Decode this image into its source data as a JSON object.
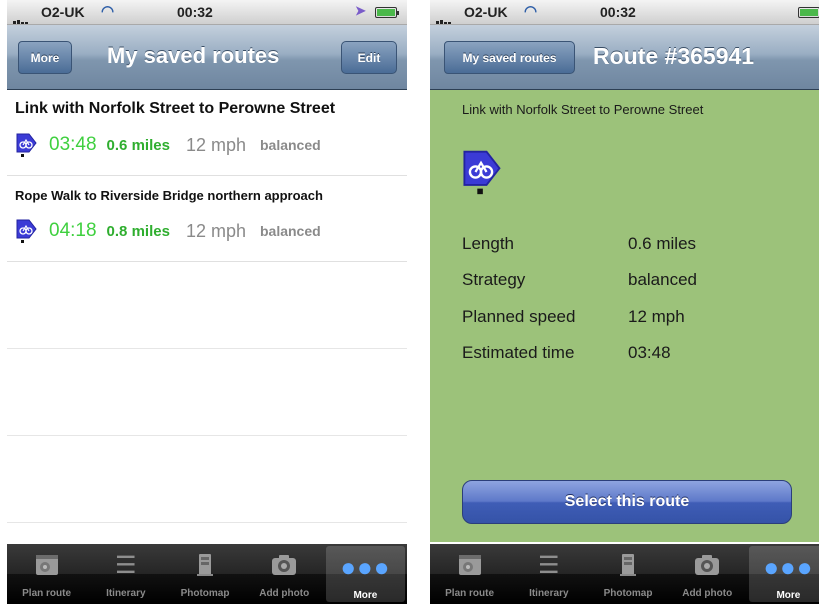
{
  "status_bar": {
    "carrier": "O2-UK",
    "time": "00:32"
  },
  "left_screen": {
    "nav": {
      "title": "My saved routes",
      "back_label": "More",
      "edit_label": "Edit"
    },
    "routes": [
      {
        "name": "Link with Norfolk Street to Perowne Street",
        "time": "03:48",
        "distance": "0.6 miles",
        "speed": "12 mph",
        "strategy": "balanced",
        "icon": "cycle-route-icon"
      },
      {
        "name": "Rope Walk to Riverside Bridge northern approach",
        "time": "04:18",
        "distance": "0.8 miles",
        "speed": "12 mph",
        "strategy": "balanced",
        "icon": "cycle-route-icon"
      }
    ]
  },
  "right_screen": {
    "nav": {
      "title": "Route #365941",
      "back_label": "My saved routes"
    },
    "route_name": "Link with Norfolk Street to Perowne Street",
    "details": {
      "length_label": "Length",
      "length_value": "0.6 miles",
      "strategy_label": "Strategy",
      "strategy_value": "balanced",
      "speed_label": "Planned speed",
      "speed_value": "12 mph",
      "time_label": "Estimated time",
      "time_value": "03:48"
    },
    "select_button": "Select this route"
  },
  "tab_bar": {
    "tabs": [
      {
        "label": "Plan route",
        "icon": "map-icon"
      },
      {
        "label": "Itinerary",
        "icon": "list-icon"
      },
      {
        "label": "Photomap",
        "icon": "photomap-icon"
      },
      {
        "label": "Add photo",
        "icon": "camera-icon"
      },
      {
        "label": "More",
        "icon": "more-icon"
      }
    ],
    "active": "More"
  },
  "colors": {
    "time_green": "#3fd03f",
    "distance_green": "#2fae2f",
    "detail_background": "#9cc27a",
    "select_button_blue": "#3f5db6"
  }
}
